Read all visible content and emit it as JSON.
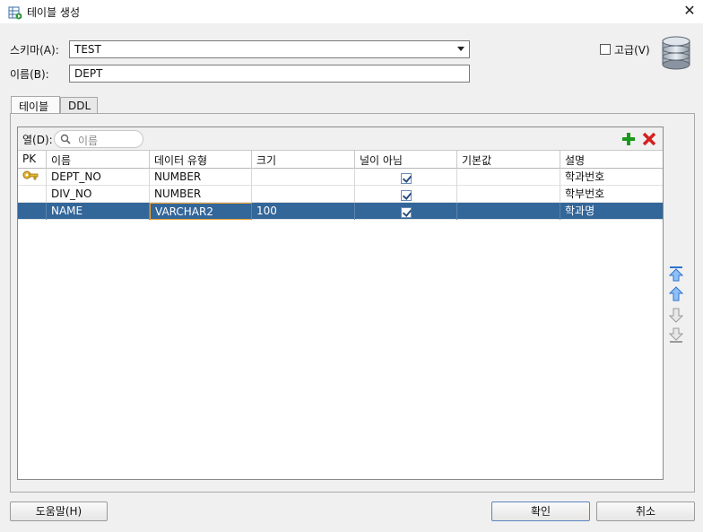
{
  "window": {
    "title": "테이블 생성",
    "close_glyph": "✕"
  },
  "schema": {
    "label": "스키마(A):",
    "value": "TEST"
  },
  "name": {
    "label": "이름(B):",
    "value": "DEPT"
  },
  "advanced": {
    "label": "고급(V)",
    "checked": false
  },
  "tabs": [
    {
      "label": "테이블",
      "active": true
    },
    {
      "label": "DDL",
      "active": false
    }
  ],
  "columns_filter": {
    "label": "열(D):",
    "placeholder": "이름"
  },
  "table": {
    "headers": [
      "PK",
      "이름",
      "데이터 유형",
      "크기",
      "널이 아님",
      "기본값",
      "설명"
    ],
    "rows": [
      {
        "pk": true,
        "name": "DEPT_NO",
        "type": "NUMBER",
        "size": "",
        "not_null": true,
        "default": "",
        "comment": "학과번호",
        "selected": false
      },
      {
        "pk": false,
        "name": "DIV_NO",
        "type": "NUMBER",
        "size": "",
        "not_null": true,
        "default": "",
        "comment": "학부번호",
        "selected": false
      },
      {
        "pk": false,
        "name": "NAME",
        "type": "VARCHAR2",
        "size": "100",
        "not_null": true,
        "default": "",
        "comment": "학과명",
        "selected": true
      }
    ]
  },
  "icons": {
    "add": "add-column-icon",
    "remove": "remove-column-icon",
    "move_top": "move-top-icon",
    "move_up": "move-up-icon",
    "move_down": "move-down-icon",
    "move_bottom": "move-bottom-icon",
    "database": "database-icon",
    "table": "table-icon",
    "key": "key-icon",
    "search": "search-icon"
  },
  "buttons": {
    "help": "도움말(H)",
    "ok": "확인",
    "cancel": "취소"
  },
  "colors": {
    "selection": "#336699",
    "add_green": "#1a9a1a",
    "remove_red": "#d42020",
    "arrow_blue": "#2f74d0"
  }
}
